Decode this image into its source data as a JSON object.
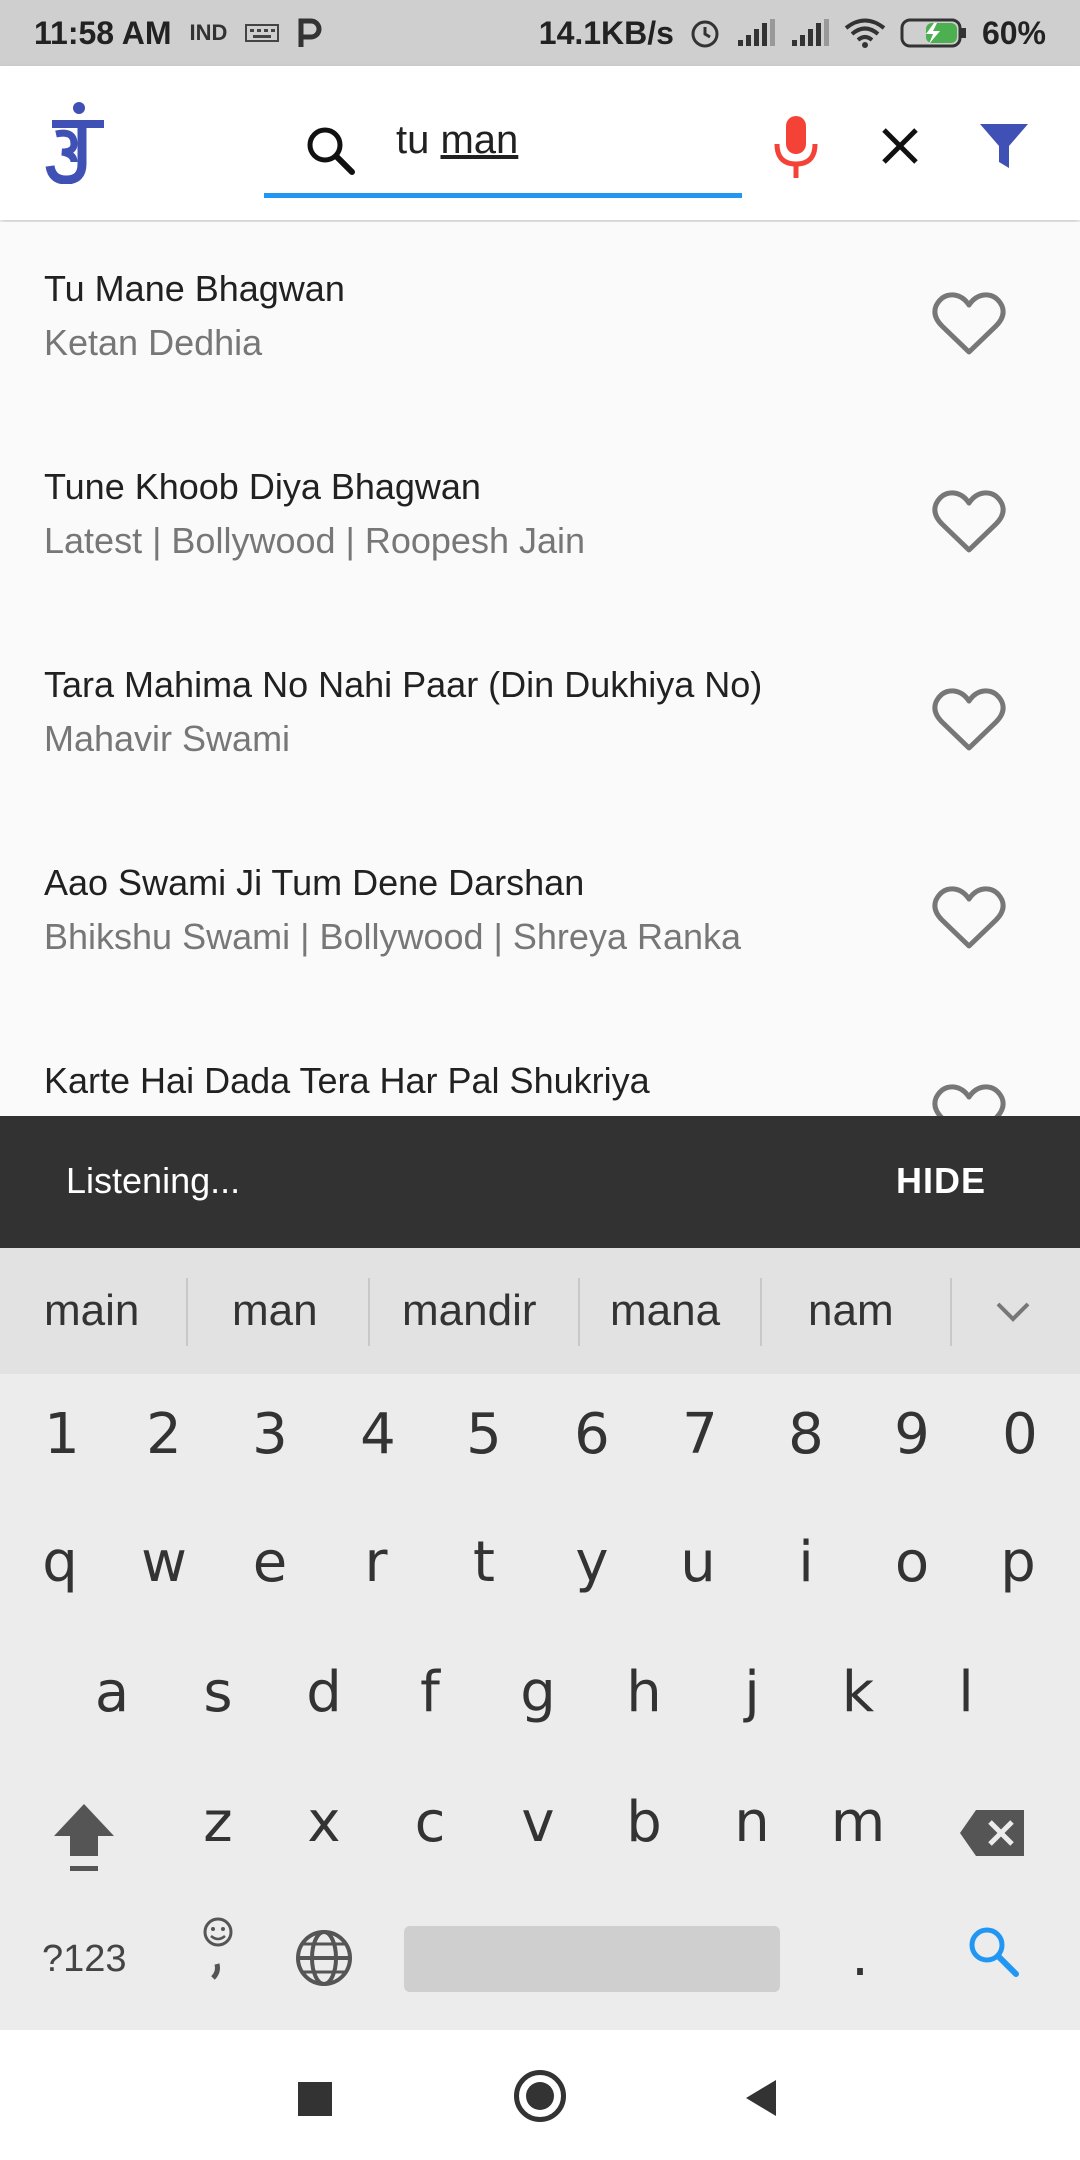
{
  "status": {
    "time": "11:58 AM",
    "carrier": "IND",
    "speed": "14.1KB/s",
    "battery": "60%"
  },
  "search": {
    "query_prefix": "tu ",
    "query_word": "man"
  },
  "songs": [
    {
      "title": "Tu Mane Bhagwan",
      "subtitle": "Ketan Dedhia"
    },
    {
      "title": "Tune Khoob Diya Bhagwan",
      "subtitle": "Latest | Bollywood | Roopesh Jain"
    },
    {
      "title": "Tara Mahima No Nahi Paar (Din Dukhiya No)",
      "subtitle": "Mahavir Swami"
    },
    {
      "title": "Aao Swami Ji Tum Dene Darshan",
      "subtitle": "Bhikshu Swami | Bollywood | Shreya Ranka"
    },
    {
      "title": "Karte Hai Dada Tera Har Pal Shukriya",
      "subtitle": ""
    }
  ],
  "snackbar": {
    "message": "Listening...",
    "action": "HIDE"
  },
  "keyboard": {
    "suggestions": [
      "main",
      "man",
      "mandir",
      "mana",
      "nam"
    ],
    "numbers": [
      "1",
      "2",
      "3",
      "4",
      "5",
      "6",
      "7",
      "8",
      "9",
      "0"
    ],
    "row1": [
      "q",
      "w",
      "e",
      "r",
      "t",
      "y",
      "u",
      "i",
      "o",
      "p"
    ],
    "row2": [
      "a",
      "s",
      "d",
      "f",
      "g",
      "h",
      "j",
      "k",
      "l"
    ],
    "row3": [
      "z",
      "x",
      "c",
      "v",
      "b",
      "n",
      "m"
    ],
    "symbols_key": "?123",
    "period_key": "."
  },
  "colors": {
    "accent": "#2196f3",
    "brand": "#3f51b5",
    "mic": "#f44336",
    "snackbar": "#323232"
  }
}
